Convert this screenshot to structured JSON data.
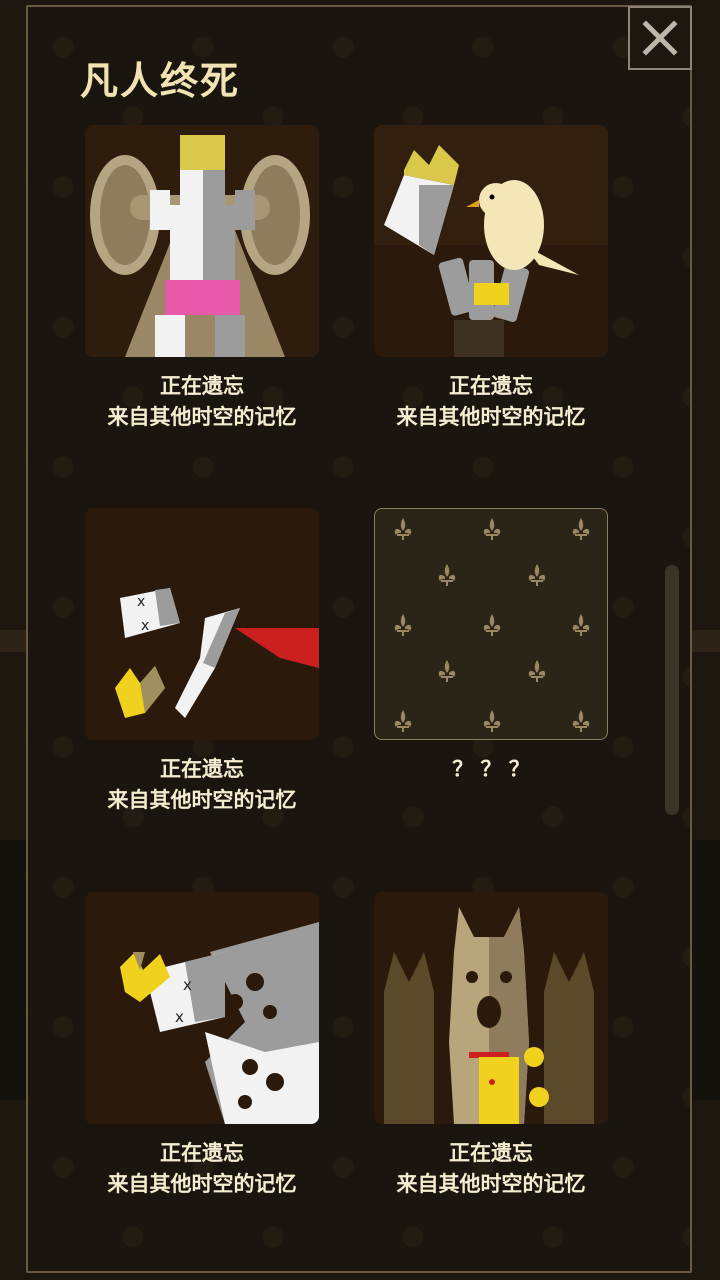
{
  "title": "凡人终死",
  "close_icon": "close-icon",
  "cards": [
    {
      "line1": "正在遗忘",
      "line2": "来自其他时空的记忆",
      "locked": false
    },
    {
      "line1": "正在遗忘",
      "line2": "来自其他时空的记忆",
      "locked": false
    },
    {
      "line1": "正在遗忘",
      "line2": "来自其他时空的记忆",
      "locked": false
    },
    {
      "line1": "？ ？ ？",
      "line2": "",
      "locked": true
    },
    {
      "line1": "正在遗忘",
      "line2": "来自其他时空的记忆",
      "locked": false
    },
    {
      "line1": "正在遗忘",
      "line2": "来自其他时空的记忆",
      "locked": false
    }
  ],
  "colors": {
    "background": "#1d1710",
    "panel_border": "#6b5a42",
    "title": "#f2e3b3",
    "caption": "#f5ecd2",
    "locked_pattern": "#9b8862"
  }
}
